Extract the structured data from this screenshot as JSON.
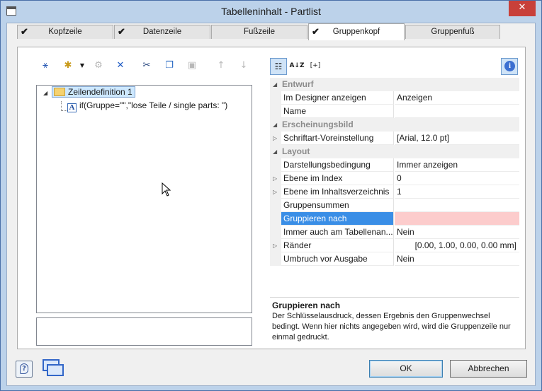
{
  "window": {
    "title": "Tabelleninhalt - Partlist",
    "close_glyph": "✕"
  },
  "tabs": [
    {
      "label": "Kopfzeile",
      "checked": true
    },
    {
      "label": "Datenzeile",
      "checked": true
    },
    {
      "label": "Fußzeile",
      "checked": false
    },
    {
      "label": "Gruppenkopf",
      "checked": true,
      "active": true
    },
    {
      "label": "Gruppenfuß",
      "checked": false
    }
  ],
  "tree": {
    "root_label": "Zeilendefinition  1",
    "child_label": "if(Gruppe=\"\",\"lose Teile / single parts: \")"
  },
  "property_grid": {
    "rows": [
      {
        "type": "category",
        "name": "Entwurf"
      },
      {
        "type": "prop",
        "name": "Im Designer anzeigen",
        "value": "Anzeigen"
      },
      {
        "type": "prop",
        "name": "Name",
        "value": ""
      },
      {
        "type": "category",
        "name": "Erscheinungsbild"
      },
      {
        "type": "prop",
        "name": "Schriftart-Voreinstellung",
        "value": "[Arial, 12.0 pt]",
        "expandable": true
      },
      {
        "type": "category",
        "name": "Layout"
      },
      {
        "type": "prop",
        "name": "Darstellungsbedingung",
        "value": "Immer anzeigen"
      },
      {
        "type": "prop",
        "name": "Ebene im Index",
        "value": "0",
        "expandable": true
      },
      {
        "type": "prop",
        "name": "Ebene im Inhaltsverzeichnis",
        "value": "1",
        "expandable": true
      },
      {
        "type": "prop",
        "name": "Gruppensummen",
        "value": ""
      },
      {
        "type": "prop",
        "name": "Gruppieren nach",
        "value": "",
        "selected": true
      },
      {
        "type": "prop",
        "name": "Immer auch am Tabellenan...",
        "value": "Nein"
      },
      {
        "type": "prop",
        "name": "Ränder",
        "value": "[0.00, 1.00, 0.00, 0.00 mm]",
        "expandable": true
      },
      {
        "type": "prop",
        "name": "Umbruch vor Ausgabe",
        "value": "Nein"
      }
    ]
  },
  "description": {
    "title": "Gruppieren nach",
    "text": "Der Schlüsselausdruck, dessen Ergebnis den Gruppenwechsel bedingt. Wenn hier nichts angegeben wird, wird die Gruppenzeile nur einmal gedruckt."
  },
  "buttons": {
    "ok": "OK",
    "cancel": "Abbrechen"
  },
  "toolbar_glyphs": {
    "sort_alpha": "A↓Z",
    "expand_all": "[+]",
    "info": "i",
    "help": "?"
  },
  "colors": {
    "selection": "#3a8ee6",
    "selected_value_bg": "#fccccc",
    "titlebar": "#bcd2ea",
    "close": "#c8403a"
  }
}
